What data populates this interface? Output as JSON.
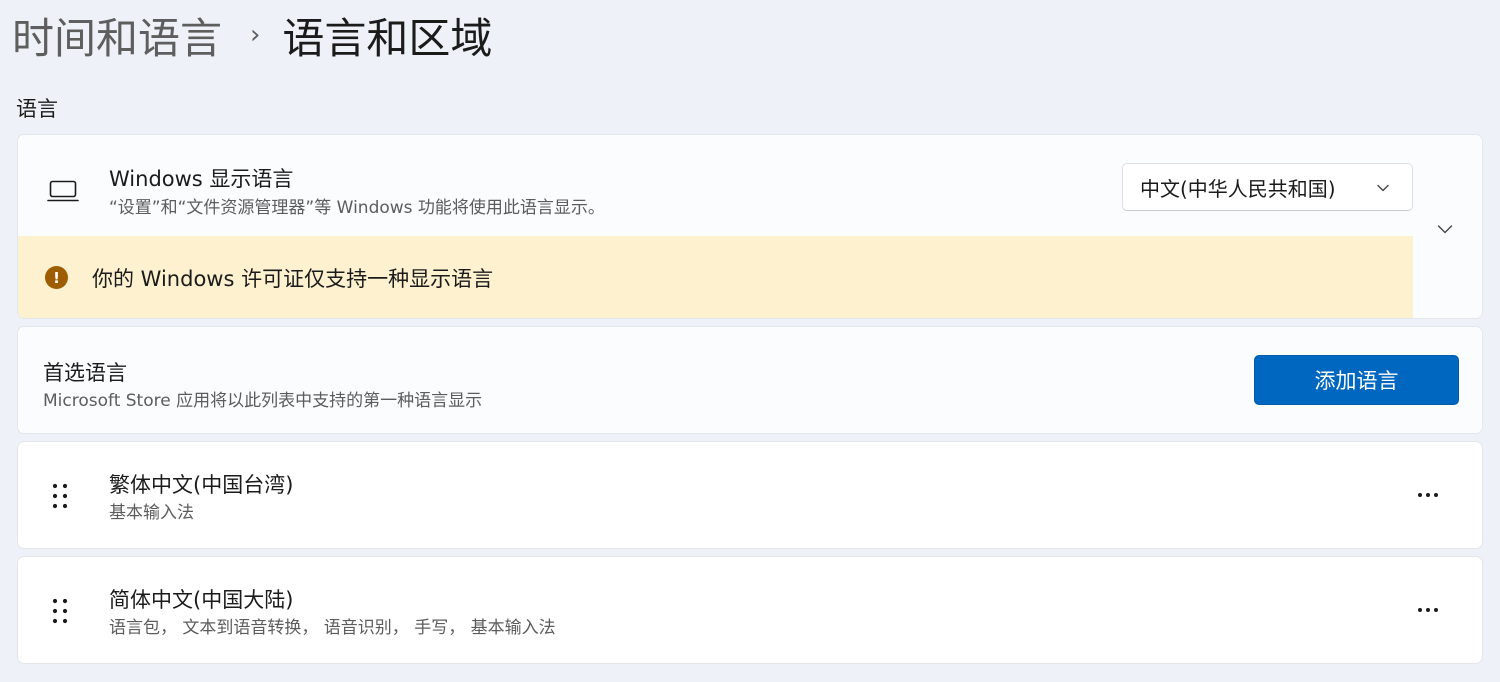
{
  "breadcrumb": {
    "parent": "时间和语言",
    "separator": "›",
    "current": "语言和区域"
  },
  "section": {
    "label": "语言"
  },
  "display_language": {
    "icon": "monitor-icon",
    "title": "Windows 显示语言",
    "description": "“设置”和“文件资源管理器”等 Windows 功能将使用此语言显示。",
    "dropdown_value": "中文(中华人民共和国)",
    "warning_text": "你的 Windows 许可证仅支持一种显示语言"
  },
  "preferred": {
    "title": "首选语言",
    "description": "Microsoft Store 应用将以此列表中支持的第一种语言显示",
    "add_button": "添加语言"
  },
  "languages": [
    {
      "title": "繁体中文(中国台湾)",
      "description": "基本输入法"
    },
    {
      "title": "简体中文(中国大陆)",
      "description": "语言包， 文本到语音转换， 语音识别， 手写， 基本输入法"
    }
  ],
  "colors": {
    "accent": "#0067c0",
    "warning_bg": "#fdf1d0",
    "warning_icon": "#9d5d00",
    "page_bg": "#eef2f8"
  }
}
